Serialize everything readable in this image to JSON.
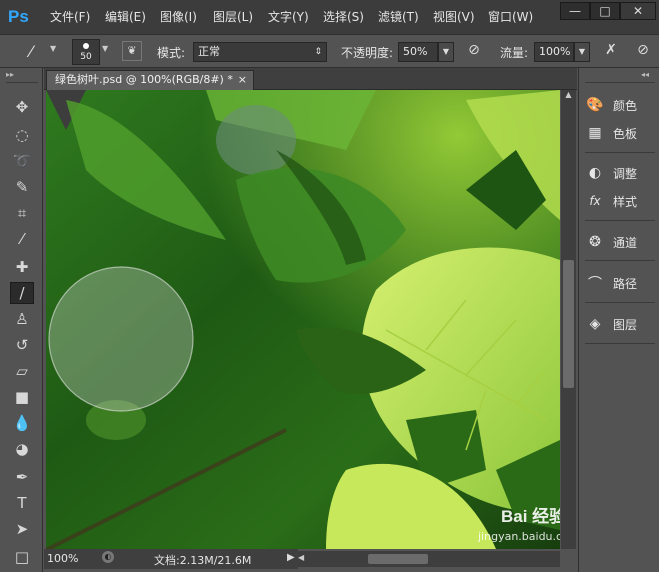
{
  "app": {
    "logo": "Ps"
  },
  "menu": [
    "文件(F)",
    "编辑(E)",
    "图像(I)",
    "图层(L)",
    "文字(Y)",
    "选择(S)",
    "滤镜(T)",
    "视图(V)",
    "窗口(W)"
  ],
  "window_controls": {
    "minimize": "—",
    "restore": "□",
    "close": "✕"
  },
  "options": {
    "brush_size": "50",
    "mode_label": "模式:",
    "mode_value": "正常",
    "opacity_label": "不透明度:",
    "opacity_value": "50%",
    "flow_label": "流量:",
    "flow_value": "100%"
  },
  "document": {
    "tab_title": "绿色树叶.psd @ 100%(RGB/8#) *",
    "tab_close": "×"
  },
  "status": {
    "zoom": "100%",
    "doc_info": "文档:2.13M/21.6M"
  },
  "right_panels": [
    {
      "label": "颜色",
      "icon": "palette-icon"
    },
    {
      "label": "色板",
      "icon": "swatches-icon"
    },
    {
      "label": "调整",
      "icon": "adjustments-icon"
    },
    {
      "label": "样式",
      "icon": "styles-fx-icon"
    },
    {
      "label": "通道",
      "icon": "channels-icon"
    },
    {
      "label": "路径",
      "icon": "paths-icon"
    },
    {
      "label": "图层",
      "icon": "layers-icon"
    }
  ],
  "tools": [
    {
      "name": "move-tool-icon",
      "glyph": "✥"
    },
    {
      "name": "marquee-tool-icon",
      "glyph": "◌"
    },
    {
      "name": "lasso-tool-icon",
      "glyph": "ʘ"
    },
    {
      "name": "quick-select-tool-icon",
      "glyph": "✎"
    },
    {
      "name": "crop-tool-icon",
      "glyph": "⌗"
    },
    {
      "name": "eyedropper-tool-icon",
      "glyph": "⁄"
    },
    {
      "name": "healing-brush-tool-icon",
      "glyph": "✚"
    },
    {
      "name": "brush-tool-icon",
      "glyph": "/"
    },
    {
      "name": "clone-stamp-tool-icon",
      "glyph": "♙"
    },
    {
      "name": "history-brush-tool-icon",
      "glyph": "↺"
    },
    {
      "name": "eraser-tool-icon",
      "glyph": "▱"
    },
    {
      "name": "gradient-tool-icon",
      "glyph": "■"
    },
    {
      "name": "blur-tool-icon",
      "glyph": "●"
    },
    {
      "name": "dodge-tool-icon",
      "glyph": "◕"
    },
    {
      "name": "pen-tool-icon",
      "glyph": "✒"
    },
    {
      "name": "type-tool-icon",
      "glyph": "T"
    },
    {
      "name": "path-select-tool-icon",
      "glyph": "➤"
    },
    {
      "name": "rectangle-tool-icon",
      "glyph": "□"
    }
  ],
  "watermark": {
    "brand": "Bai 经验",
    "url": "jingyan.baidu.com"
  },
  "colors": {
    "ps_blue": "#31a8ff",
    "menubar": "#3c3c3c",
    "panel": "#535353",
    "leaf_light": "#b7e04a",
    "leaf_dark": "#2f6b1a"
  }
}
